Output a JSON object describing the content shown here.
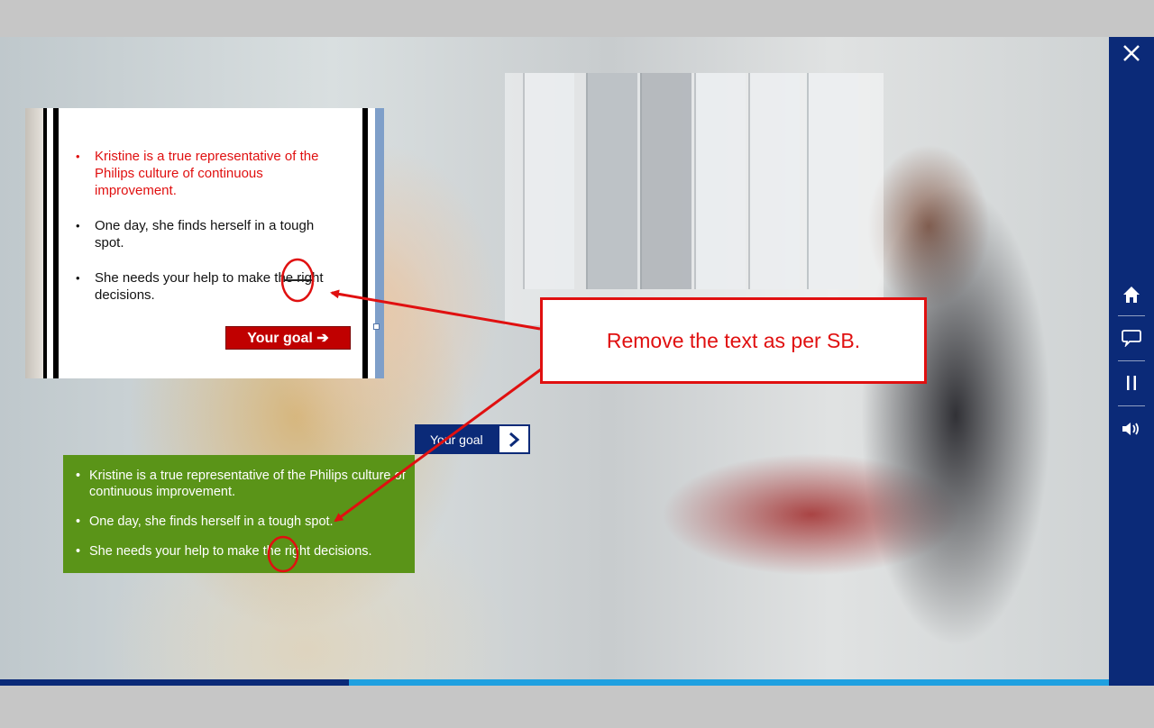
{
  "sidebar": {
    "close_icon": "close-icon",
    "items": [
      {
        "icon": "home-icon"
      },
      {
        "icon": "comment-icon"
      },
      {
        "icon": "pause-icon"
      },
      {
        "icon": "volume-icon"
      }
    ]
  },
  "progress": {
    "fraction": 0.315
  },
  "slide": {
    "bullets": [
      "Kristine is a true representative of the Philips culture of continuous improvement.",
      "One day, she finds herself in a tough spot.",
      "She needs your help to make the right decisions."
    ],
    "goal_button": "Your goal ➔"
  },
  "green_box": {
    "bullets": [
      "Kristine is a true representative of the Philips culture of continuous improvement.",
      "One day, she finds herself in a tough spot.",
      "She needs your help to make the right decisions."
    ]
  },
  "nav_goal": {
    "label": "Your goal"
  },
  "annotation": {
    "text": "Remove the text as per SB.",
    "color": "#e01010"
  },
  "colors": {
    "sidebar": "#0b2a78",
    "progress_track": "#1fa0e0",
    "green_box": "#5a9418",
    "goal_button": "#c00000"
  }
}
